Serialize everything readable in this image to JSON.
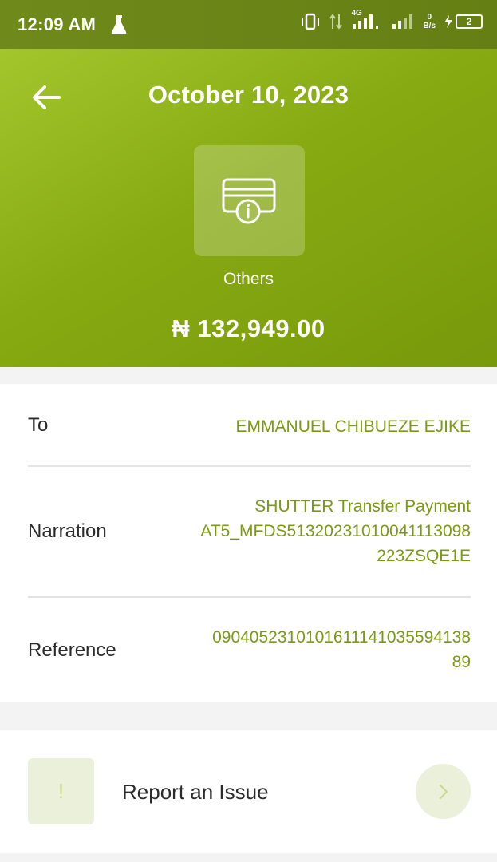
{
  "status_bar": {
    "time": "12:09 AM",
    "network_type": "4G",
    "speed_value": "0",
    "speed_unit": "B/s",
    "battery_level": "2",
    "icons": [
      "flask-icon",
      "vibrate-icon",
      "data-arrows-icon",
      "signal-icon",
      "signal-icon",
      "speed-icon",
      "charging-icon",
      "battery-icon"
    ]
  },
  "header": {
    "title": "October 10, 2023",
    "category_icon": "card-info-icon",
    "category": "Others",
    "amount": "₦ 132,949.00",
    "back_icon": "back-arrow-icon"
  },
  "details": [
    {
      "label": "To",
      "value_lines": [
        "EMMANUEL CHIBUEZE EJIKE"
      ]
    },
    {
      "label": "Narration",
      "value_lines": [
        "SHUTTER Transfer Payment",
        "AT5_MFDS5132023101004111309​8",
        "223ZSQE1E"
      ]
    },
    {
      "label": "Reference",
      "value_lines": [
        "090405231010161114103559413​8",
        "89"
      ]
    }
  ],
  "report": {
    "label": "Report an Issue",
    "icon_glyph": "!",
    "chevron_icon": "chevron-right-icon"
  },
  "colors": {
    "brand_green": "#87aa12",
    "value_text": "#7a9a12",
    "soft_green": "#eaf0d9"
  }
}
